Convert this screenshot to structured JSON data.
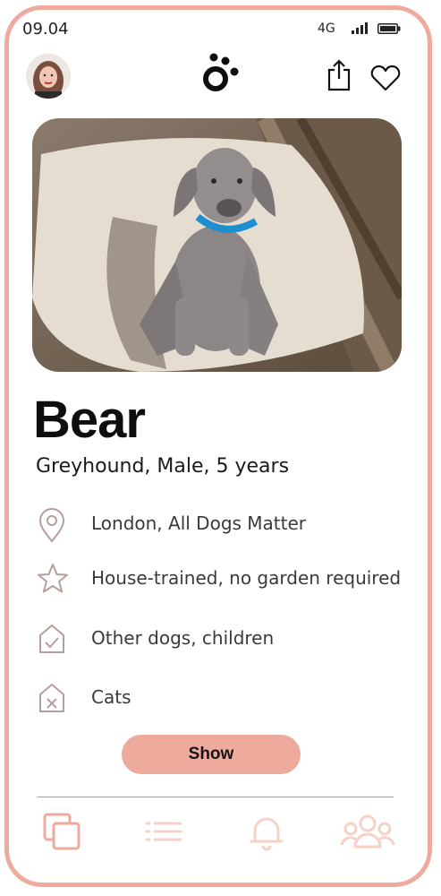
{
  "status": {
    "time": "09.04",
    "network": "4G"
  },
  "pet": {
    "name": "Bear",
    "details": "Greyhound, Male, 5 years"
  },
  "features": [
    {
      "icon": "location-pin-icon",
      "text": "London, All Dogs Matter"
    },
    {
      "icon": "star-icon",
      "text": "House-trained, no garden required"
    },
    {
      "icon": "house-check-icon",
      "text": "Other dogs, children"
    },
    {
      "icon": "house-cross-icon",
      "text": "Cats"
    }
  ],
  "actions": {
    "show_label": "Show"
  },
  "colors": {
    "accent": "#eeaa9d",
    "accent_light": "#f6d1c8",
    "icon_grey": "#b59f9b"
  },
  "bottom_nav": [
    {
      "icon": "cards-icon",
      "active": true
    },
    {
      "icon": "list-icon",
      "active": false
    },
    {
      "icon": "bell-icon",
      "active": false
    },
    {
      "icon": "group-icon",
      "active": false
    }
  ]
}
